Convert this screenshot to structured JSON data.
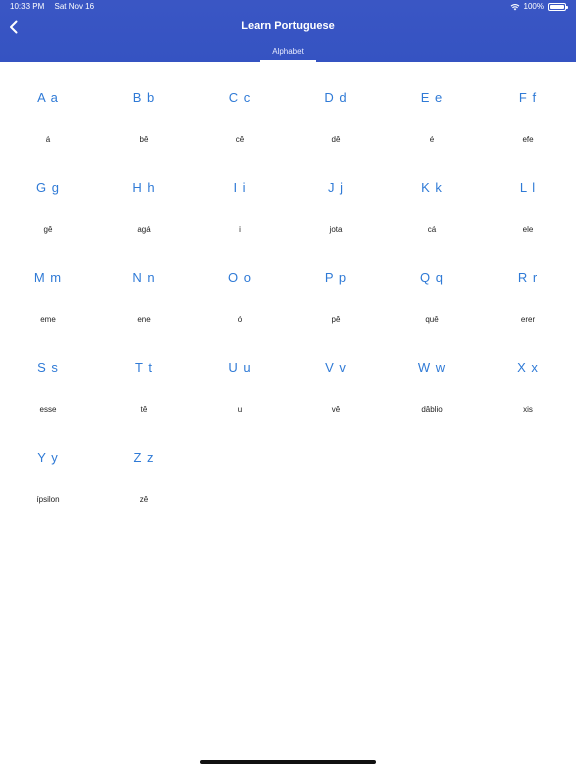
{
  "status": {
    "time": "10:33 PM",
    "date": "Sat Nov 16",
    "battery": "100%"
  },
  "nav": {
    "title": "Learn Portuguese",
    "tab": "Alphabet"
  },
  "colors": {
    "header": "#3553c2",
    "letter": "#2f7ad6"
  },
  "letters": [
    {
      "letter": "A a",
      "name": "á"
    },
    {
      "letter": "B b",
      "name": "bê"
    },
    {
      "letter": "C c",
      "name": "cê"
    },
    {
      "letter": "D d",
      "name": "dê"
    },
    {
      "letter": "E e",
      "name": "é"
    },
    {
      "letter": "F f",
      "name": "efe"
    },
    {
      "letter": "G g",
      "name": "gê"
    },
    {
      "letter": "H h",
      "name": "agá"
    },
    {
      "letter": "I i",
      "name": "i"
    },
    {
      "letter": "J j",
      "name": "jota"
    },
    {
      "letter": "K k",
      "name": "cá"
    },
    {
      "letter": "L l",
      "name": "ele"
    },
    {
      "letter": "M m",
      "name": "eme"
    },
    {
      "letter": "N n",
      "name": "ene"
    },
    {
      "letter": "O o",
      "name": "ó"
    },
    {
      "letter": "P p",
      "name": "pê"
    },
    {
      "letter": "Q q",
      "name": "quê"
    },
    {
      "letter": "R r",
      "name": "erer"
    },
    {
      "letter": "S s",
      "name": "esse"
    },
    {
      "letter": "T t",
      "name": "tê"
    },
    {
      "letter": "U u",
      "name": "u"
    },
    {
      "letter": "V v",
      "name": "vê"
    },
    {
      "letter": "W w",
      "name": "dâblio"
    },
    {
      "letter": "X x",
      "name": "xis"
    },
    {
      "letter": "Y y",
      "name": "ípsilon"
    },
    {
      "letter": "Z z",
      "name": "zê"
    }
  ]
}
